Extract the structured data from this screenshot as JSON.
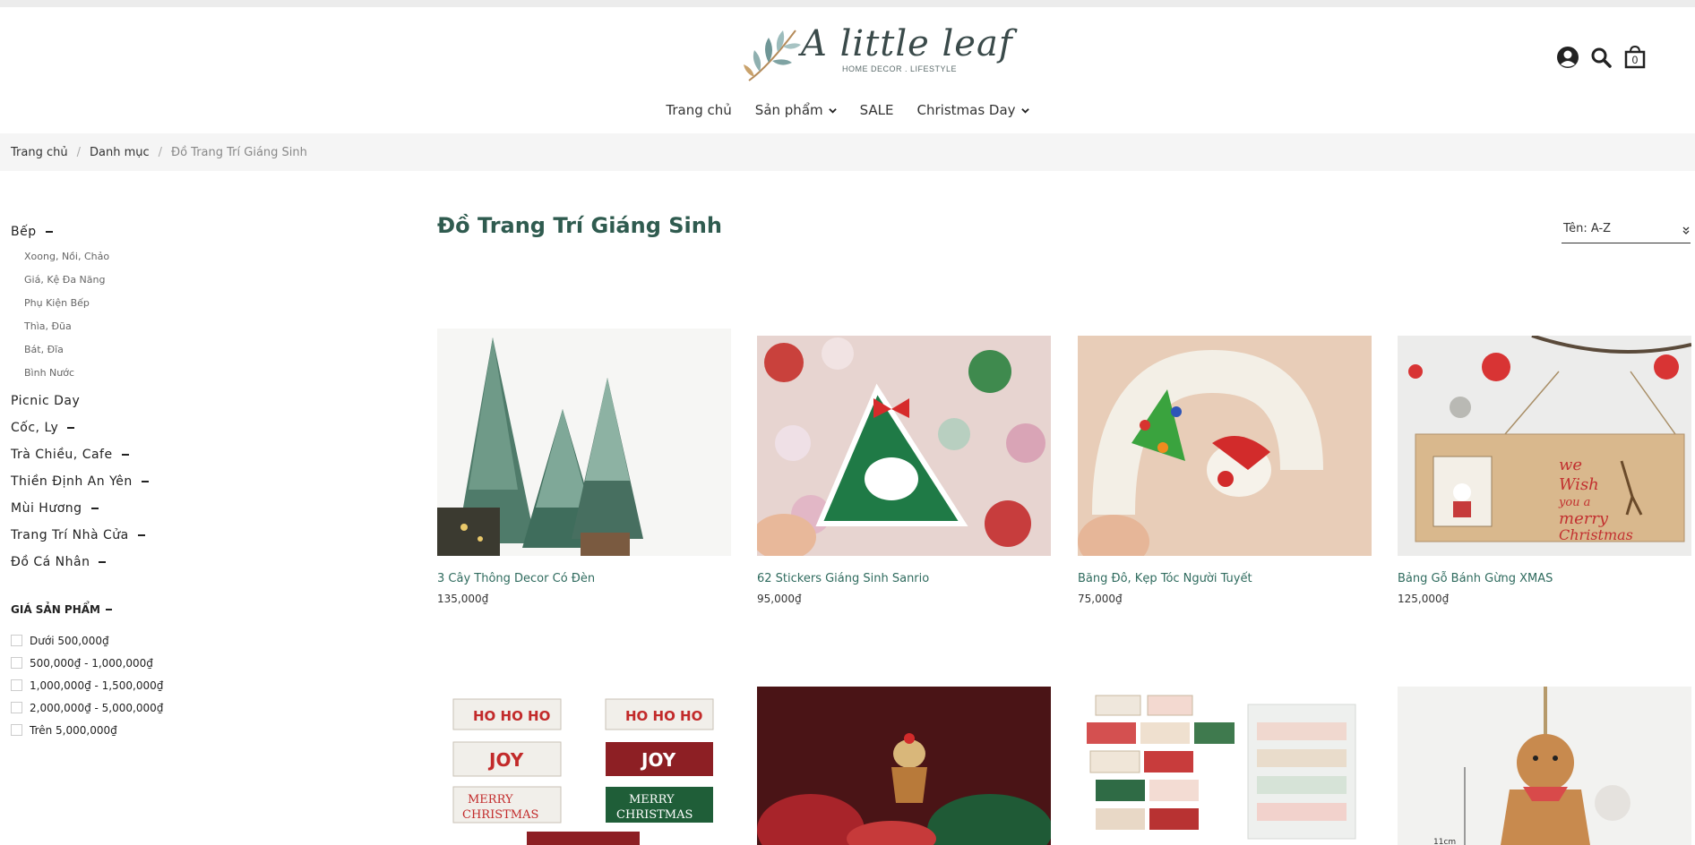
{
  "brand": {
    "name": "A little leaf",
    "tagline": "HOME DECOR . LIFESTYLE"
  },
  "header": {
    "cart_count": "0"
  },
  "nav": {
    "items": [
      {
        "label": "Trang chủ",
        "has_dropdown": false
      },
      {
        "label": "Sản phẩm",
        "has_dropdown": true
      },
      {
        "label": "SALE",
        "has_dropdown": false
      },
      {
        "label": "Christmas Day",
        "has_dropdown": true
      }
    ]
  },
  "breadcrumb": [
    "Trang chủ",
    "Danh mục",
    "Đồ Trang Trí Giáng Sinh"
  ],
  "sidebar": {
    "categories": [
      {
        "label": "Bếp",
        "expanded": true,
        "children": [
          "Xoong, Nồi, Chảo",
          "Giá, Kệ Đa Năng",
          "Phụ Kiện Bếp",
          "Thìa, Đũa",
          "Bát, Đĩa",
          "Bình Nước"
        ]
      },
      {
        "label": "Picnic Day",
        "expanded": false
      },
      {
        "label": "Cốc, Ly",
        "expanded": true
      },
      {
        "label": "Trà Chiều, Cafe",
        "expanded": true
      },
      {
        "label": "Thiền Định An Yên",
        "expanded": true
      },
      {
        "label": "Mùi Hương",
        "expanded": true
      },
      {
        "label": "Trang Trí Nhà Cửa",
        "expanded": true
      },
      {
        "label": "Đồ Cá Nhân",
        "expanded": true
      }
    ],
    "price_filter": {
      "title": "GIÁ SẢN PHẨM",
      "options": [
        "Dưới 500,000₫",
        "500,000₫ - 1,000,000₫",
        "1,000,000₫ - 1,500,000₫",
        "2,000,000₫ - 5,000,000₫",
        "Trên 5,000,000₫"
      ]
    }
  },
  "main": {
    "title": "Đồ Trang Trí Giáng Sinh",
    "sort_value": "Tên: A-Z"
  },
  "products": [
    {
      "name": "3 Cây Thông Decor Có Đèn",
      "price": "135,000₫"
    },
    {
      "name": "62 Stickers Giáng Sinh Sanrio",
      "price": "95,000₫"
    },
    {
      "name": "Băng Đô, Kẹp Tóc Người Tuyết",
      "price": "75,000₫"
    },
    {
      "name": "Bảng Gỗ Bánh Gừng XMAS",
      "price": "125,000₫"
    },
    {
      "name": "",
      "price": ""
    },
    {
      "name": "",
      "price": ""
    },
    {
      "name": "",
      "price": ""
    },
    {
      "name": "",
      "price": ""
    }
  ],
  "product_image_text": {
    "hohoho": "HO HO HO",
    "joy": "JOY",
    "merry": "MERRY",
    "christmas": "CHRISTMAS",
    "wish_line1": "we",
    "wish_line2": "Wish",
    "wish_line3": "you a",
    "wish_line4": "merry",
    "wish_line5": "Christmas",
    "dimension": "11cm"
  },
  "colors": {
    "accent_green": "#2f5b4f",
    "product_name": "#2f6b5e",
    "breadcrumb_bg": "#f5f5f5"
  }
}
